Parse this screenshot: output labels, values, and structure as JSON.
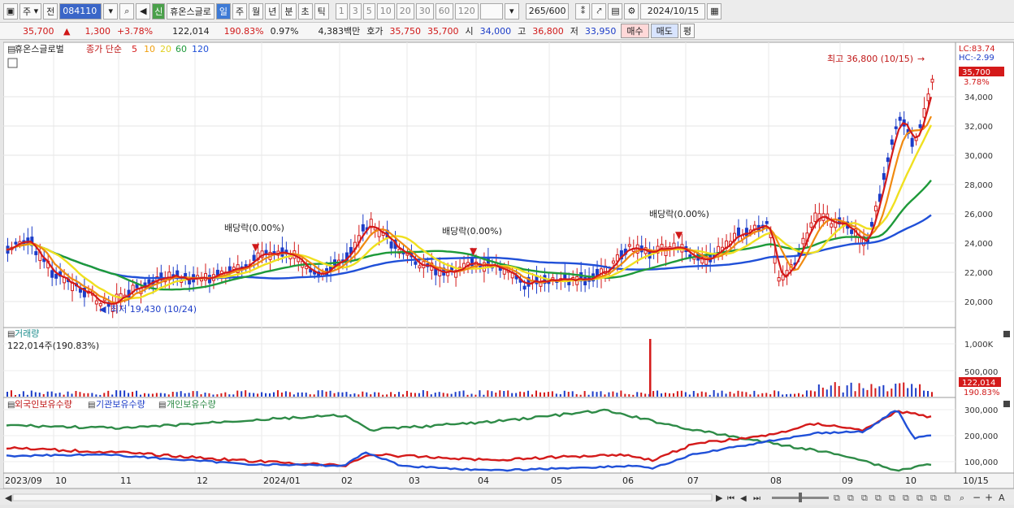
{
  "toolbar": {
    "market": "주",
    "mode": "전",
    "code": "084110",
    "name": "휴온스글로",
    "new_badge": "신",
    "periods": [
      "일",
      "주",
      "월",
      "년",
      "분",
      "초",
      "틱"
    ],
    "intervals": [
      "1",
      "3",
      "5",
      "10",
      "20",
      "30",
      "60",
      "120"
    ],
    "count": "265",
    "count_total": "/600",
    "date": "2024/10/15"
  },
  "quote": {
    "price": "35,700",
    "arrow": "▲",
    "change": "1,300",
    "change_pct": "+3.78%",
    "volume": "122,014",
    "vol_ratio": "190.83%",
    "turnover": "0.97%",
    "amount": "4,383백만",
    "bid_label": "호가",
    "bid": "35,750",
    "ask": "35,700",
    "open_label": "시",
    "open": "34,000",
    "high_label": "고",
    "high": "36,800",
    "low_label": "저",
    "low": "33,950",
    "buy_label": "매수",
    "sell_label": "매도",
    "avg_label": "평"
  },
  "price_panel": {
    "title": "휴온스글로벌",
    "ma_label": "종가 단순",
    "ma_periods": [
      "5",
      "10",
      "20",
      "60",
      "120"
    ],
    "ma_colors": [
      "#d41a1a",
      "#f08a10",
      "#f0e020",
      "#1e9a3a",
      "#2050d8"
    ],
    "y_ticks": [
      "34,000",
      "32,000",
      "30,000",
      "28,000",
      "26,000",
      "24,000",
      "22,000",
      "20,000"
    ],
    "lc": "LC:83.74",
    "hc": "HC:-2.99",
    "cur_price_tag": "35,700",
    "cur_pct": "3.78%",
    "high_note": "최고 36,800 (10/15)",
    "low_note": "최저 19,430 (10/24)",
    "dividend_notes": [
      "배당락(0.00%)",
      "배당락(0.00%)",
      "배당락(0.00%)"
    ]
  },
  "volume_panel": {
    "title": "거래량",
    "current": "122,014주(190.83%)",
    "y_ticks": [
      "1,000K",
      "500,000"
    ],
    "tag": "122,014",
    "tag_pct": "190.83%"
  },
  "holder_panel": {
    "legend": [
      "외국인보유수량",
      "기관보유수량",
      "개인보유수량"
    ],
    "legend_colors": [
      "#d41a1a",
      "#2050d8",
      "#2e8b47"
    ],
    "y_ticks": [
      "300,000",
      "200,000",
      "100,000"
    ]
  },
  "x_axis": {
    "labels": [
      "2023/09",
      "10",
      "11",
      "12",
      "2024/01",
      "02",
      "03",
      "04",
      "05",
      "06",
      "07",
      "08",
      "09",
      "10"
    ],
    "end_label": "10/15"
  }
}
